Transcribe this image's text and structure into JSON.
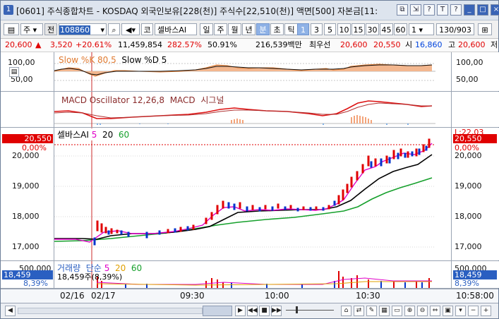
{
  "window": {
    "title": "[0601] 주식종합차트 - KOSDAQ 외국인보유[228(천)] 주식수[22,510(천)] 액면[500] 자본금[11:",
    "badge": "1",
    "ctrl_icons": [
      "restore-icon",
      "link-icon",
      "help-icon",
      "text-icon",
      "settings-icon",
      "minimize-icon",
      "maximize-icon",
      "close-icon"
    ]
  },
  "toolbar": {
    "period_select": "주",
    "prev_label": "전",
    "code_value": "108860",
    "market_label": "코",
    "stock_name": "셀바스AI",
    "period_buttons": [
      "일",
      "주",
      "월",
      "년",
      "분",
      "초",
      "틱"
    ],
    "selected_period": "분",
    "interval_buttons": [
      "1",
      "3",
      "5",
      "10",
      "15",
      "30",
      "45",
      "60"
    ],
    "selected_interval": "1",
    "interval_value": "1",
    "count_value": "130/903"
  },
  "quote": {
    "price": "20,600",
    "change_arrow": "▲",
    "change": "3,520",
    "change_pct": "+20.61%",
    "volume": "11,459,854",
    "vol_ratio": "282.57%",
    "turnover": "50.91%",
    "amount": "216,539백만",
    "best_label": "최우선",
    "ask": "20,600",
    "bid": "20,550",
    "open_label": "시",
    "open": "16,860",
    "high_label": "고",
    "high": "20,600",
    "low_label": "저"
  },
  "stoch_panel": {
    "legend_k": "Slow %K 80,5",
    "legend_d": "Slow %D 5",
    "axis": [
      "100,00",
      "50,00"
    ]
  },
  "macd_panel": {
    "legend_osc": "MACD Oscillator 12,26,8",
    "legend_macd": "MACD",
    "legend_sig": "시그널"
  },
  "price_panel": {
    "legend_name": "셀바스AI",
    "ma": [
      "5",
      "20",
      "60"
    ],
    "axis": [
      "20,000",
      "19,000",
      "18,000",
      "17,000"
    ],
    "current_price": "20,550",
    "current_pct": "0,00%",
    "right_max": "L:22,03",
    "right_price": "20,550",
    "right_pct": "0,00%",
    "axis_right": [
      "20,000",
      "19,000",
      "18,000",
      "17,000"
    ]
  },
  "volume_panel": {
    "legend": "거래량",
    "legend2": "단순",
    "ma": [
      "5",
      "20",
      "60"
    ],
    "value_line": "18,459주(8,39%)",
    "axis_top": "500,000",
    "current": "18,459",
    "current_pct": "8,39%",
    "right_top": "500,000",
    "right_current": "18,459",
    "right_pct": "8,39%"
  },
  "time_axis": {
    "labels": [
      "02/16",
      "02/17",
      "09:30",
      "10:00",
      "10:30"
    ],
    "clock": "10:58:00"
  },
  "colors": {
    "up": "#e00000",
    "down": "#0033cc",
    "ma5": "#e000c8",
    "ma20": "#000000",
    "ma60": "#16a02c",
    "stoch_fill": "#f3b78f"
  }
}
